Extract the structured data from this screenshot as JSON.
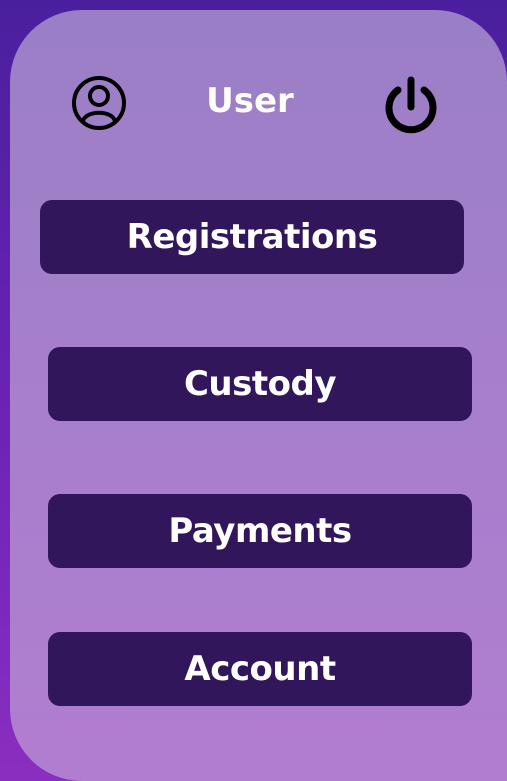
{
  "header": {
    "title": "User",
    "user_icon": "user-circle-icon",
    "power_icon": "power-icon"
  },
  "menu": {
    "items": [
      {
        "label": "Registrations"
      },
      {
        "label": "Custody"
      },
      {
        "label": "Payments"
      },
      {
        "label": "Account"
      }
    ]
  },
  "colors": {
    "background": "#5a22a8",
    "panel": "#a77fcc",
    "button": "#32165c",
    "button_text": "#ffffff",
    "icon": "#000000"
  }
}
